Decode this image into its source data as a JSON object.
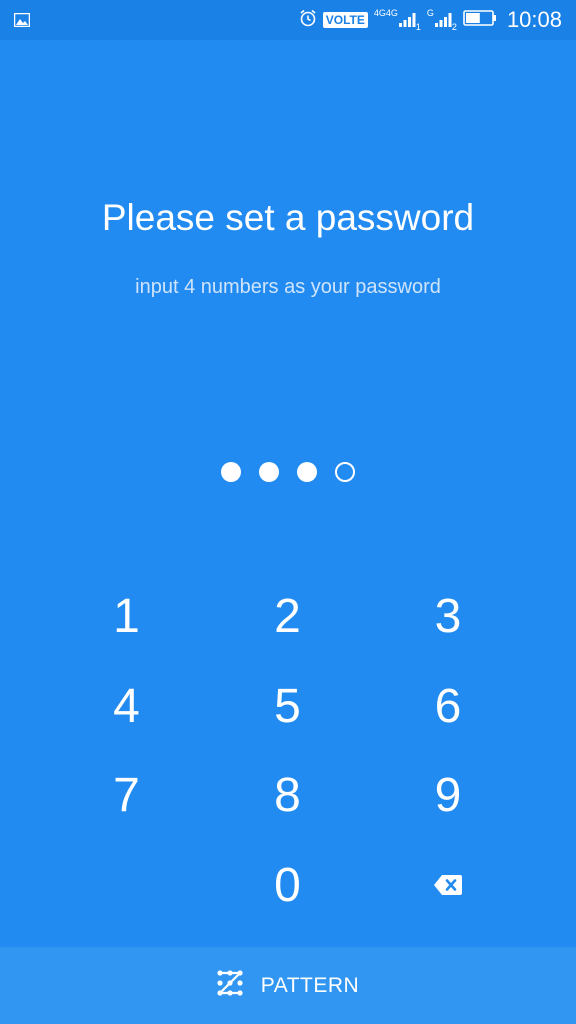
{
  "status_bar": {
    "volte": "VOLTE",
    "sim1_network": "4G",
    "sim1_network_alt": "4G",
    "sim1_slot": "1",
    "sim2_network": "G",
    "sim2_slot": "2",
    "time": "10:08",
    "battery_level": 0.55
  },
  "header": {
    "title": "Please set a password",
    "subtitle": "input 4 numbers as your password"
  },
  "pin": {
    "length": 4,
    "entered": 3
  },
  "keypad": {
    "keys": [
      "1",
      "2",
      "3",
      "4",
      "5",
      "6",
      "7",
      "8",
      "9",
      "",
      "0",
      "backspace-icon"
    ]
  },
  "bottom": {
    "label": "PATTERN",
    "icon": "pattern-icon"
  },
  "colors": {
    "background": "#218bf1",
    "status_bar": "#1a81e6",
    "bottom_bar": "#3196f2",
    "foreground": "#ffffff"
  }
}
